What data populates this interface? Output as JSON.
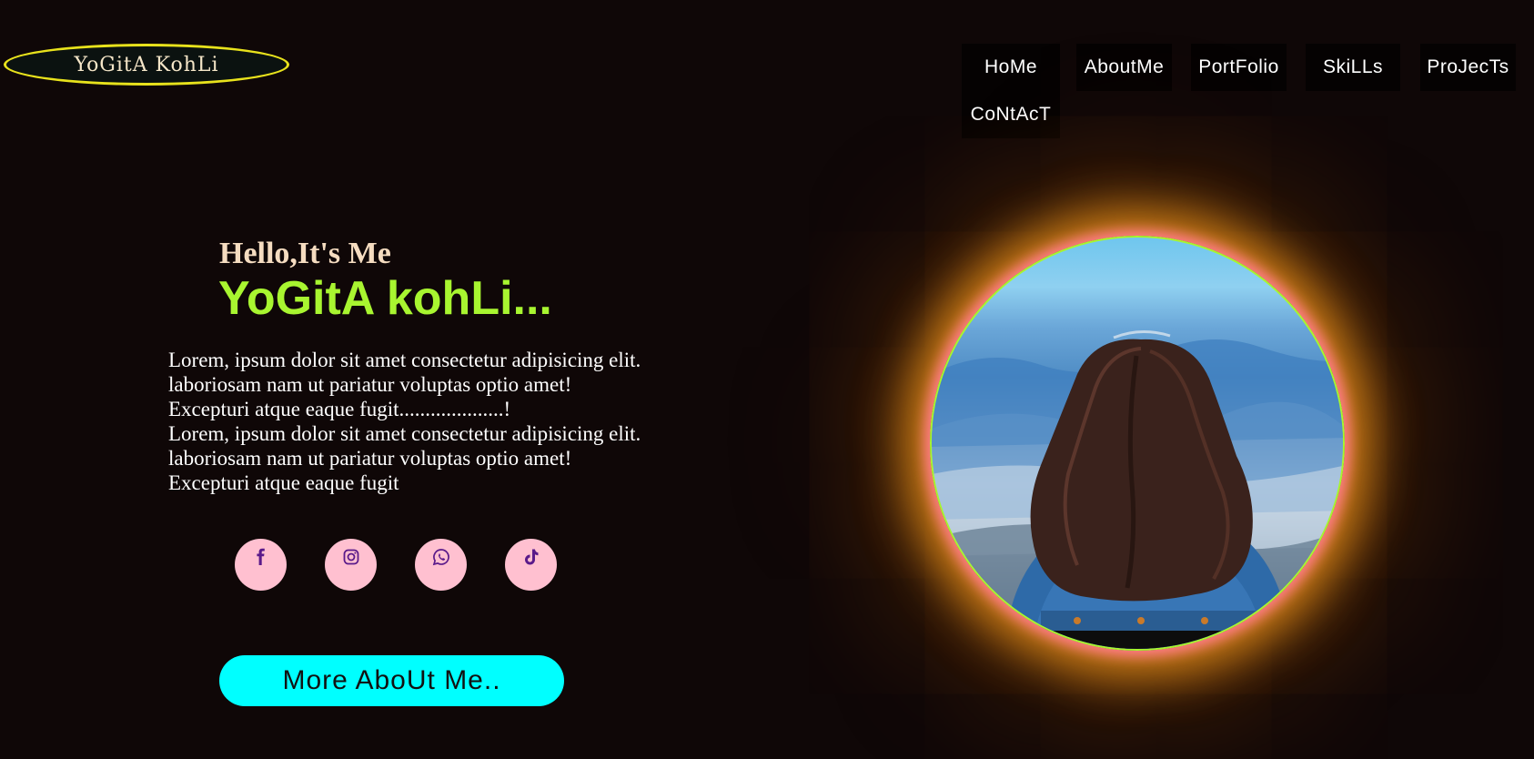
{
  "logo": {
    "text": "YoGitA KohLi"
  },
  "nav": {
    "items": [
      "HoMe",
      "AboutMe",
      "PortFolio",
      "SkiLLs",
      "ProJecTs",
      "CoNtAcT"
    ]
  },
  "hero": {
    "greeting": "Hello,It's Me",
    "name": "YoGitA kohLi...",
    "description_lines": [
      "Lorem, ipsum dolor sit amet consectetur adipisicing elit.",
      "laboriosam nam ut pariatur voluptas optio amet!",
      "Excepturi atque eaque fugit....................!",
      "Lorem, ipsum dolor sit amet consectetur adipisicing elit.",
      "laboriosam nam ut pariatur voluptas optio amet!",
      "Excepturi atque eaque fugit"
    ],
    "social_icons": [
      "facebook-icon",
      "instagram-icon",
      "whatsapp-icon",
      "tiktok-icon"
    ],
    "cta_label": "More AboUt Me.."
  },
  "colors": {
    "background": "#0f0707",
    "logo_border": "#e8e21c",
    "name_green": "#a8f530",
    "greeting": "#f5dcc0",
    "social_bg": "#ffc0d0",
    "social_icon": "#5a1a8a",
    "cta_bg": "#00ffff",
    "glow_orange": "#e08a18",
    "glow_pink": "#ff7a8c"
  }
}
